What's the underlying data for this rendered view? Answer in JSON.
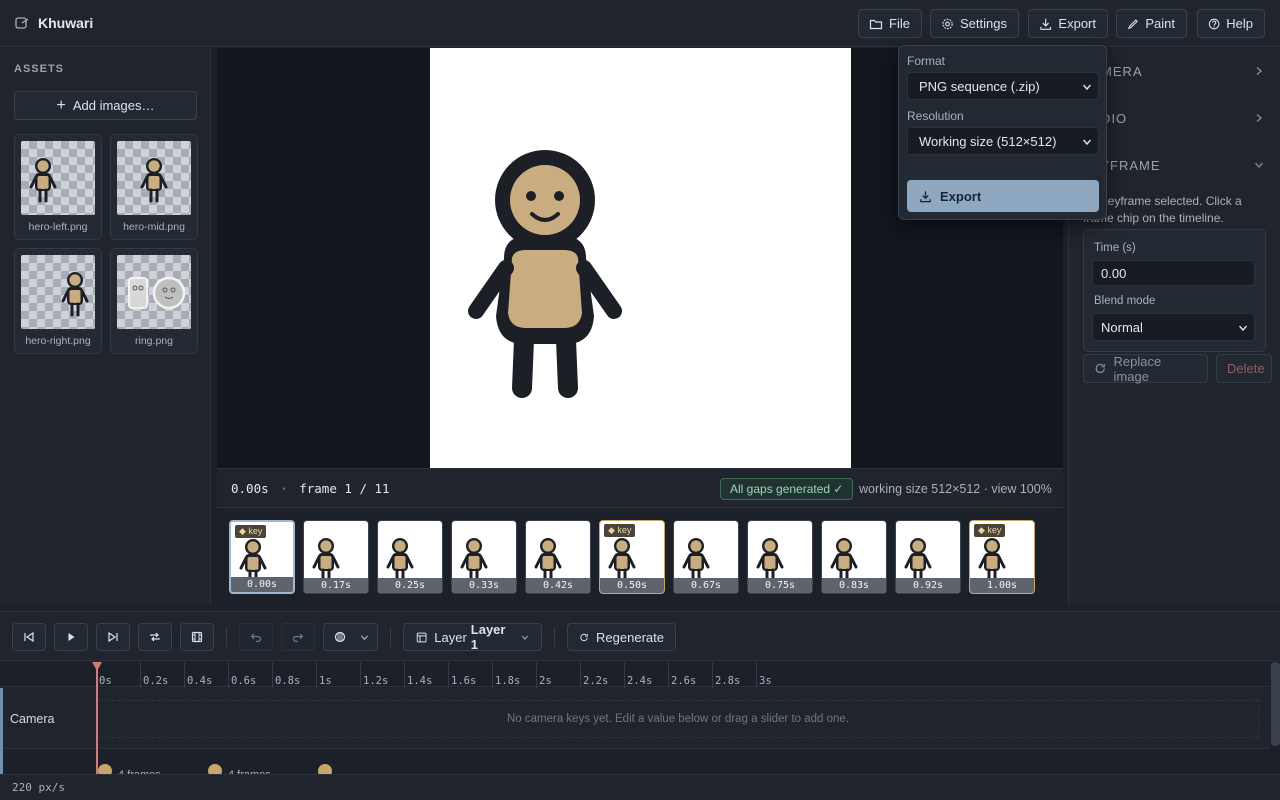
{
  "app": {
    "title": "Khuwari"
  },
  "toolbar": {
    "file_label": "File",
    "settings_label": "Settings",
    "export_label": "Export",
    "paint_label": "Paint",
    "help_label": "Help"
  },
  "assets": {
    "heading": "ASSETS",
    "add_label": "Add images…",
    "items": [
      {
        "name": "hero-left.png"
      },
      {
        "name": "hero-mid.png"
      },
      {
        "name": "hero-right.png"
      },
      {
        "name": "ring.png"
      }
    ]
  },
  "status": {
    "time": "0.00s",
    "separator": "·",
    "frame": "frame 1 / 11",
    "gaps_badge": "All gaps generated ✓",
    "working_size": "working size 512×512 · view 100%"
  },
  "frames": [
    {
      "time": "0.00s",
      "key": true,
      "selected": true
    },
    {
      "time": "0.17s",
      "key": false
    },
    {
      "time": "0.25s",
      "key": false
    },
    {
      "time": "0.33s",
      "key": false
    },
    {
      "time": "0.42s",
      "key": false
    },
    {
      "time": "0.50s",
      "key": true
    },
    {
      "time": "0.67s",
      "key": false
    },
    {
      "time": "0.75s",
      "key": false
    },
    {
      "time": "0.83s",
      "key": false
    },
    {
      "time": "0.92s",
      "key": false
    },
    {
      "time": "1.00s",
      "key": true
    }
  ],
  "frame_key_tag": "◆ key",
  "right_panel": {
    "camera_heading": "CAMERA",
    "audio_heading": "AUDIO",
    "keyframe_heading": "KEYFRAME",
    "no_key_text": "No keyframe selected. Click a frame chip on the timeline.",
    "time_label": "Time (s)",
    "time_value": "0.00",
    "blend_label": "Blend mode",
    "blend_value": "Normal",
    "replace_label": "Replace image",
    "delete_label": "Delete"
  },
  "export_popover": {
    "format_label": "Format",
    "format_value": "PNG sequence (.zip)",
    "resolution_label": "Resolution",
    "resolution_value": "Working size (512×512)",
    "export_button": "Export"
  },
  "transport": {
    "layer_prefix": "Layer",
    "layer_name": "Layer 1",
    "regenerate_label": "Regenerate"
  },
  "timeline": {
    "ticks": [
      "0s",
      "0.2s",
      "0.4s",
      "0.6s",
      "0.8s",
      "1s",
      "1.2s",
      "1.4s",
      "1.6s",
      "1.8s",
      "2s",
      "2.2s",
      "2.4s",
      "2.6s",
      "2.8s",
      "3s"
    ],
    "camera_label": "Camera",
    "camera_hint": "No camera keys yet. Edit a value below or drag a slider to add one.",
    "layer_key_label": "4 frames",
    "zoom": "220 px/s"
  },
  "colors": {
    "accent": "#8ea8c2",
    "key": "#c6a66b",
    "playhead": "#d47a7a",
    "success": "#9fd3bb"
  }
}
